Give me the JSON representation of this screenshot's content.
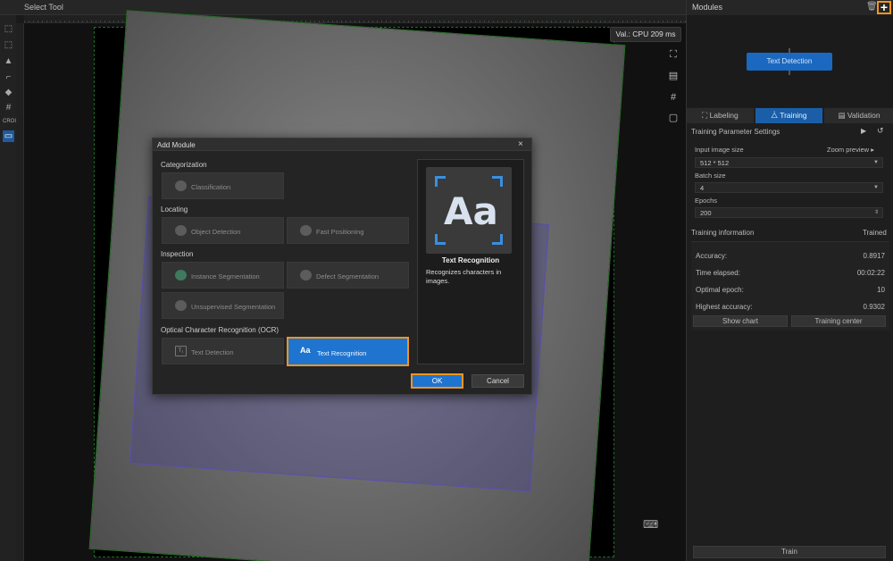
{
  "topbar": {
    "title": "Select Tool"
  },
  "canvas": {
    "val_badge": "Val.: CPU 209 ms"
  },
  "left_tools": [
    "select-icon",
    "box-select-icon",
    "stamp-icon",
    "polygon-icon",
    "eraser-icon",
    "grid-icon",
    "roi-icon",
    "mask-icon"
  ],
  "left_tools_roi_label": "CROI",
  "right_panel": {
    "title": "Modules",
    "add_label": "+",
    "flow_node": "Text Detection",
    "tabs": [
      {
        "label": "Labeling",
        "icon": "labeling-icon"
      },
      {
        "label": "Training",
        "icon": "training-icon"
      },
      {
        "label": "Validation",
        "icon": "validation-icon"
      }
    ],
    "training_params": {
      "title": "Training Parameter Settings",
      "input_size_label": "Input image size",
      "zoom_preview": "Zoom preview",
      "input_size_value": "512 * 512",
      "batch_label": "Batch size",
      "batch_value": "4",
      "epochs_label": "Epochs",
      "epochs_value": "200"
    },
    "training_info": {
      "title": "Training information",
      "status": "Trained",
      "rows": [
        {
          "label": "Accuracy:",
          "value": "0.8917"
        },
        {
          "label": "Time elapsed:",
          "value": "00:02:22"
        },
        {
          "label": "Optimal epoch:",
          "value": "10"
        },
        {
          "label": "Highest accuracy:",
          "value": "0.9302"
        }
      ],
      "show_chart": "Show chart",
      "training_center": "Training center"
    },
    "train_button": "Train"
  },
  "dialog": {
    "title": "Add Module",
    "close": "×",
    "categories": [
      {
        "name": "Categorization",
        "modules": [
          "Classification"
        ]
      },
      {
        "name": "Locating",
        "modules": [
          "Object Detection",
          "Fast Positioning"
        ]
      },
      {
        "name": "Inspection",
        "modules": [
          "Instance Segmentation",
          "Defect Segmentation",
          "Unsupervised Segmentation"
        ]
      },
      {
        "name": "Optical Character Recognition (OCR)",
        "modules": [
          "Text Detection",
          "Text Recognition"
        ]
      }
    ],
    "tile_icons": {
      "text_detection": "T₁",
      "text_recognition": "Aa"
    },
    "selected_module": "Text Recognition",
    "preview": {
      "image_text": "Aa",
      "title": "Text Recognition",
      "description": "Recognizes characters in images."
    },
    "ok": "OK",
    "cancel": "Cancel"
  },
  "colors": {
    "accent": "#1f74d0",
    "highlight": "#f0961e",
    "panel": "#1e1e1e"
  }
}
